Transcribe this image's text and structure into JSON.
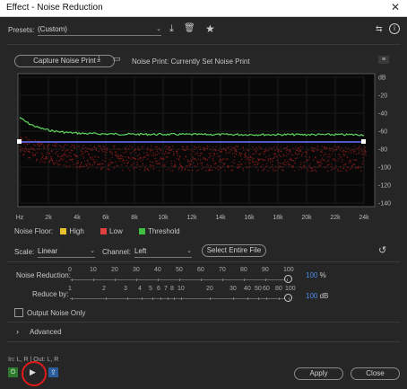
{
  "window": {
    "title": "Effect - Noise Reduction"
  },
  "presets": {
    "label": "Presets:",
    "value": "(Custom)"
  },
  "capture": {
    "button": "Capture Noise Print",
    "noise_print_label": "Noise Print: Currently Set Noise Print"
  },
  "graph": {
    "y_ticks": [
      "dB",
      "-20",
      "-40",
      "-60",
      "-80",
      "-100",
      "-120",
      "-140"
    ],
    "x_ticks": [
      "Hz",
      "2k",
      "4k",
      "6k",
      "8k",
      "10k",
      "12k",
      "14k",
      "16k",
      "18k",
      "20k",
      "22k",
      "24k"
    ],
    "legend_title": "Noise Floor:",
    "legend": [
      {
        "label": "High",
        "color": "#e8c02a"
      },
      {
        "label": "Low",
        "color": "#e04040"
      },
      {
        "label": "Threshold",
        "color": "#3fbf3f"
      }
    ]
  },
  "scale": {
    "label": "Scale:",
    "value": "Linear"
  },
  "channel": {
    "label": "Channel:",
    "value": "Left"
  },
  "select_entire_file": "Select Entire File",
  "noise_reduction": {
    "label": "Noise Reduction:",
    "ticks": [
      "0",
      "10",
      "20",
      "30",
      "40",
      "50",
      "60",
      "70",
      "80",
      "90",
      "100"
    ],
    "value": "100",
    "unit": "%"
  },
  "reduce_by": {
    "label": "Reduce by:",
    "ticks": [
      "1",
      "2",
      "3",
      "4",
      "5",
      "6",
      "7",
      "8",
      "10",
      "20",
      "30",
      "40",
      "50",
      "60",
      "80",
      "100"
    ],
    "value": "100",
    "unit": "dB"
  },
  "output_noise_only": "Output Noise Only",
  "advanced": "Advanced",
  "io_label": "In: L, R | Out: L, R",
  "apply_button": "Apply",
  "close_button": "Close",
  "highlight_color": "#e01a1a"
}
